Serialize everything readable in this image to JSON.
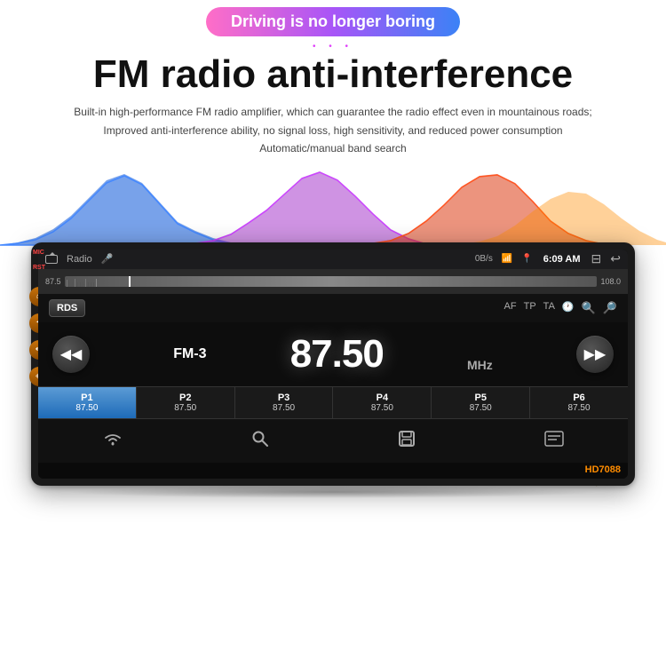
{
  "header": {
    "badge": "Driving is no longer boring",
    "dots": "• • •",
    "title": "FM radio anti-interference",
    "subtitle_line1": "Built-in high-performance FM radio amplifier, which can guarantee the radio effect even in mountainous roads;",
    "subtitle_line2": "Improved anti-interference ability, no signal loss, high sensitivity, and reduced power consumption",
    "subtitle_line3": "Automatic/manual band search"
  },
  "device": {
    "status_bar": {
      "title": "Radio",
      "info": "0B/s",
      "time": "6:09 AM",
      "mic_label": "MIC",
      "rst_label": "RST"
    },
    "freq_scale": {
      "left": "87.5",
      "right": "108.0"
    },
    "rds_btn": "RDS",
    "radio_options": [
      "AF",
      "TP",
      "TA"
    ],
    "station": "FM-3",
    "frequency": "87.50",
    "mhz": "MHz",
    "prev_btn": "◀◀",
    "next_btn": "▶▶",
    "presets": [
      {
        "num": "P1",
        "freq": "87.50",
        "active": true
      },
      {
        "num": "P2",
        "freq": "87.50",
        "active": false
      },
      {
        "num": "P3",
        "freq": "87.50",
        "active": false
      },
      {
        "num": "P4",
        "freq": "87.50",
        "active": false
      },
      {
        "num": "P5",
        "freq": "87.50",
        "active": false
      },
      {
        "num": "P6",
        "freq": "87.50",
        "active": false
      }
    ],
    "nav_icons": [
      "wifi",
      "search",
      "save",
      "menu"
    ],
    "model": "HD7088"
  },
  "watermark": "HD7088",
  "colors": {
    "badge_gradient_start": "#ff6ec7",
    "badge_gradient_end": "#3b82f6",
    "accent_orange": "#ff8c00",
    "preset_active_start": "#5b9bd5",
    "preset_active_end": "#1e6bb8"
  }
}
